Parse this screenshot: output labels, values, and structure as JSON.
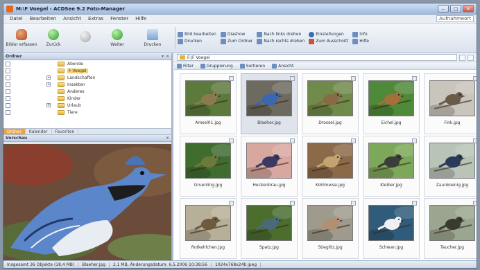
{
  "window": {
    "title": "M:\\F Voegel - ACDSee 9.2 Foto-Manager"
  },
  "menu": [
    "Datei",
    "Bearbeiten",
    "Ansicht",
    "Extras",
    "Fenster",
    "Hilfe"
  ],
  "menu_extra": {
    "combo": "Aufnahmeort"
  },
  "toolbar": {
    "buttons": [
      {
        "label": "Bilder erfassen",
        "icon": "acquire-icon"
      },
      {
        "label": "Zurück",
        "icon": "back-icon"
      },
      {
        "label": "",
        "icon": "stop-icon"
      },
      {
        "label": "Weiter",
        "icon": "forward-icon"
      },
      {
        "label": "Drucken",
        "icon": "print-icon"
      }
    ],
    "small": [
      {
        "label": "Bild bearbeiten",
        "icon": "edit-icon"
      },
      {
        "label": "Drucken",
        "icon": "print-small-icon"
      },
      {
        "label": "Diashow",
        "icon": "slideshow-icon"
      },
      {
        "label": "Zum Ordner",
        "icon": "folder-icon"
      },
      {
        "label": "Nach links drehen",
        "icon": "rotate-left-icon"
      },
      {
        "label": "Nach rechts drehen",
        "icon": "rotate-right-icon"
      },
      {
        "label": "Einstellungen",
        "icon": "settings-icon"
      },
      {
        "label": "Zum Ausschnitt",
        "icon": "crop-icon"
      },
      {
        "label": "Info",
        "icon": "info-icon"
      },
      {
        "label": "Hilfe",
        "icon": "help-icon"
      }
    ]
  },
  "folders": {
    "header": "Ordner",
    "items": [
      {
        "name": "Abende",
        "level": 2,
        "expander": "",
        "selected": false
      },
      {
        "name": "F Voegel",
        "level": 2,
        "expander": "",
        "selected": true
      },
      {
        "name": "Landschaften",
        "level": 2,
        "expander": "+",
        "selected": false
      },
      {
        "name": "Insekten",
        "level": 2,
        "expander": "+",
        "selected": false
      },
      {
        "name": "Anderes",
        "level": 2,
        "expander": "",
        "selected": false
      },
      {
        "name": "Kinder",
        "level": 2,
        "expander": "",
        "selected": false
      },
      {
        "name": "Urlaub",
        "level": 2,
        "expander": "+",
        "selected": false
      },
      {
        "name": "Tiere",
        "level": 2,
        "expander": "",
        "selected": false
      }
    ],
    "tabs": [
      "Ordner",
      "Kalender",
      "Favoriten"
    ]
  },
  "preview": {
    "header": "Vorschau"
  },
  "path": {
    "value": "F:\\F Voegel"
  },
  "filterbar": [
    "Filter",
    "Gruppierung",
    "Sortieren",
    "Ansicht"
  ],
  "thumbnails": [
    {
      "name": "Amsel01.jpg",
      "selected": false,
      "bg": "#5c7a3c",
      "body": "#8b7a4f"
    },
    {
      "name": "Blaeher.jpg",
      "selected": true,
      "bg": "#6d6a60",
      "body": "#3a67b0"
    },
    {
      "name": "Drossel.jpg",
      "selected": false,
      "bg": "#6f8a4a",
      "body": "#8a6a45"
    },
    {
      "name": "Eichel.jpg",
      "selected": false,
      "bg": "#4f8a3a",
      "body": "#a2713a"
    },
    {
      "name": "Fink.jpg",
      "selected": false,
      "bg": "#c9c5bd",
      "body": "#6a5a4a"
    },
    {
      "name": "Gruenling.jpg",
      "selected": false,
      "bg": "#3f6d30",
      "body": "#6b7a3a"
    },
    {
      "name": "Heckenbrau.jpg",
      "selected": false,
      "bg": "#d8a8a0",
      "body": "#3a3a60"
    },
    {
      "name": "Kohlmeise.jpg",
      "selected": false,
      "bg": "#8a6a48",
      "body": "#c3a36f"
    },
    {
      "name": "Kleiber.jpg",
      "selected": false,
      "bg": "#7da85a",
      "body": "#3c3c3c"
    },
    {
      "name": "Zaunkoenig.jpg",
      "selected": false,
      "bg": "#b9c3b7",
      "body": "#2a3a5a"
    },
    {
      "name": "Rotkehlchen.jpg",
      "selected": false,
      "bg": "#b7b098",
      "body": "#6e5a3c"
    },
    {
      "name": "Spatz.jpg",
      "selected": false,
      "bg": "#4b6e2f",
      "body": "#4a6a7a"
    },
    {
      "name": "Stieglitz.jpg",
      "selected": false,
      "bg": "#9e9a8e",
      "body": "#b09070"
    },
    {
      "name": "Schwan.jpg",
      "selected": false,
      "bg": "#2f5c7a",
      "body": "#f0f0f0"
    },
    {
      "name": "Taucher.jpg",
      "selected": false,
      "bg": "#9aa68f",
      "body": "#3a3a2e"
    }
  ],
  "status": [
    "Insgesamt 36 Objekte (18,4 MB)",
    "Blaeher.jpg",
    "2,1 MB, Änderungsdatum: 6.5.2006 10:38:56",
    "1024x768x24b jpeg"
  ],
  "colors": {
    "accent": "#f2a33a",
    "selection": "#f7d26c"
  }
}
